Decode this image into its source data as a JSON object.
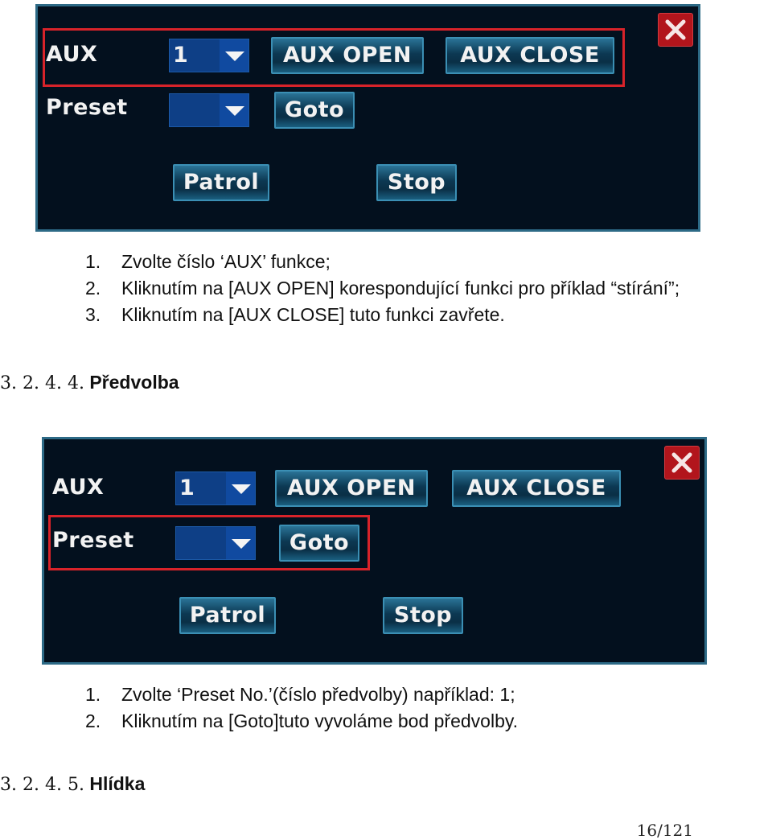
{
  "panels": [
    {
      "aux_label": "AUX",
      "aux_value": "1",
      "aux_open": "AUX OPEN",
      "aux_close": "AUX CLOSE",
      "preset_label": "Preset",
      "preset_value": "",
      "goto": "Goto",
      "patrol": "Patrol",
      "stop": "Stop",
      "highlighted_row": "AUX"
    },
    {
      "aux_label": "AUX",
      "aux_value": "1",
      "aux_open": "AUX OPEN",
      "aux_close": "AUX CLOSE",
      "preset_label": "Preset",
      "preset_value": "",
      "goto": "Goto",
      "patrol": "Patrol",
      "stop": "Stop",
      "highlighted_row": "Preset"
    }
  ],
  "aux_steps": [
    {
      "num": "1.",
      "text": "Zvolte číslo ‘AUX’ funkce;"
    },
    {
      "num": "2.",
      "text": "Kliknutím na [AUX OPEN] korespondující funkci pro příklad “stírání”;"
    },
    {
      "num": "3.",
      "text": "Kliknutím na [AUX CLOSE] tuto funkci zavřete."
    }
  ],
  "section_preset": {
    "number": "3. 2. 4. 4.",
    "title": "Předvolba"
  },
  "preset_steps": [
    {
      "num": "1.",
      "text": "Zvolte ‘Preset No.’(číslo předvolby) například: 1;"
    },
    {
      "num": "2.",
      "text": "Kliknutím na [Goto]tuto vyvoláme bod předvolby."
    }
  ],
  "section_patrol": {
    "number": "3. 2. 4. 5.",
    "title": "Hlídka"
  },
  "page_number": "16/121",
  "colors": {
    "panel_bg": "#03101e",
    "highlight": "#d8232a",
    "close_bg": "#b2151c",
    "combo_bg": "#0e3f86"
  }
}
